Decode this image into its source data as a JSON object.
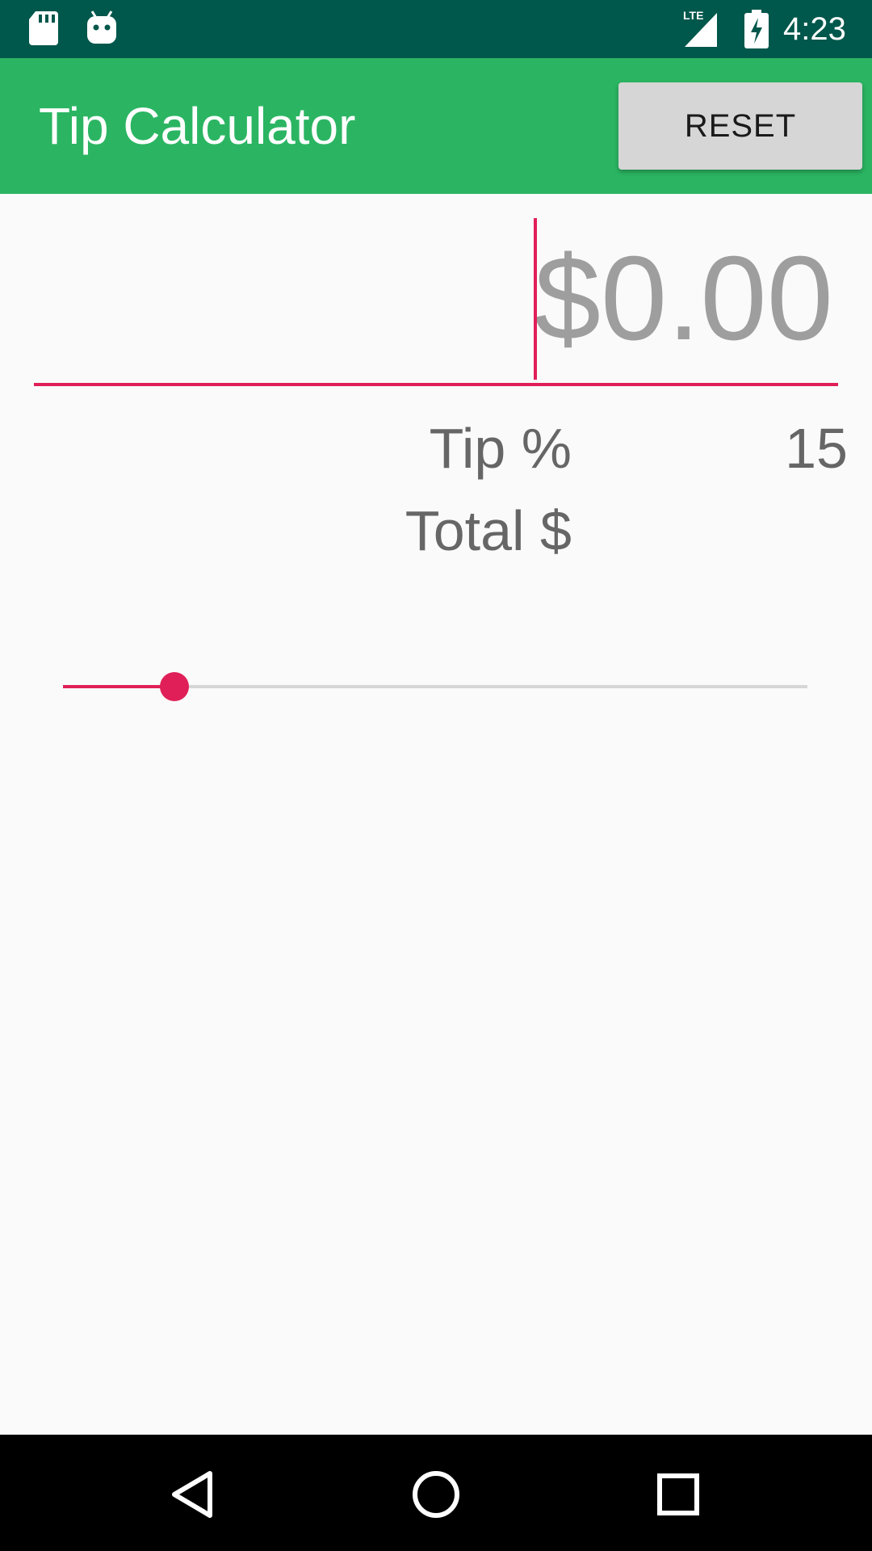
{
  "status_bar": {
    "time": "4:23",
    "network": "LTE",
    "icons": [
      "sd-card-icon",
      "android-icon",
      "lte-signal-icon",
      "battery-charging-icon"
    ]
  },
  "app_bar": {
    "title": "Tip Calculator",
    "reset_label": "RESET"
  },
  "amount": {
    "value": "",
    "placeholder": "$0.00"
  },
  "tip": {
    "label": "Tip %",
    "value": "15"
  },
  "total": {
    "label": "Total $",
    "value": ""
  },
  "slider": {
    "value": 15,
    "min": 0,
    "max": 100
  },
  "nav_bar": {
    "icons": [
      "back-icon",
      "home-icon",
      "recents-icon"
    ]
  },
  "colors": {
    "status_bar": "#00574b",
    "app_bar": "#2bb562",
    "accent": "#e01f58",
    "text_secondary": "#666666",
    "background": "#fafafa"
  }
}
